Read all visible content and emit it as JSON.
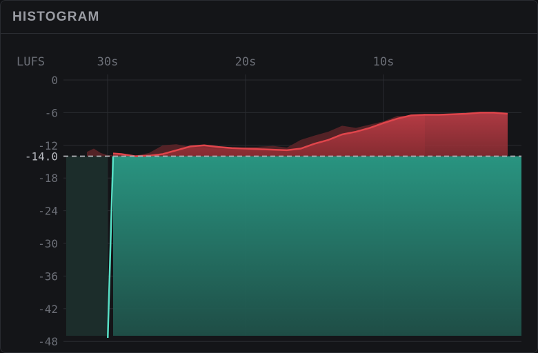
{
  "header": {
    "title": "HISTOGRAM"
  },
  "colors": {
    "background": "#141518",
    "grid": "#2a2c31",
    "text": "#6b6e76",
    "over": "#e0454b",
    "under": "#2a9b86",
    "line": "#57e0c6",
    "target": "#a6a8ad"
  },
  "chart_data": {
    "type": "area",
    "title": "",
    "ylabel": "LUFS",
    "xlabel": "",
    "x_unit": "seconds ago",
    "xlim": [
      33,
      1
    ],
    "ylim": [
      -48,
      0
    ],
    "x_ticks": [
      {
        "value": 30,
        "label": "30s"
      },
      {
        "value": 20,
        "label": "20s"
      },
      {
        "value": 10,
        "label": "10s"
      }
    ],
    "y_ticks": [
      {
        "value": 0,
        "label": "0"
      },
      {
        "value": -6,
        "label": "-6"
      },
      {
        "value": -12,
        "label": "-12"
      },
      {
        "value": -18,
        "label": "-18"
      },
      {
        "value": -24,
        "label": "-24"
      },
      {
        "value": -30,
        "label": "-30"
      },
      {
        "value": -36,
        "label": "-36"
      },
      {
        "value": -42,
        "label": "-42"
      },
      {
        "value": -48,
        "label": "-48"
      }
    ],
    "target": {
      "value": -14.0,
      "label": "-14.0"
    },
    "grid": true,
    "series": [
      {
        "x": [
          33.0,
          32.0,
          31.0,
          30.2,
          30.0,
          29.6,
          29.0,
          28.0,
          27.0,
          26.0,
          25.0,
          24.0,
          23.0,
          22.0,
          21.0,
          20.0,
          19.0,
          18.0,
          17.0,
          16.0,
          15.0,
          14.0,
          13.0,
          12.0,
          11.0,
          10.0,
          9.0,
          8.0,
          7.0,
          6.0,
          5.0,
          4.0,
          3.0,
          2.0,
          1.0
        ],
        "y": [
          -48.4,
          -48.4,
          -48.4,
          -48.4,
          -48.4,
          -13.5,
          -13.6,
          -14.0,
          -13.9,
          -13.6,
          -12.9,
          -12.2,
          -12.0,
          -12.3,
          -12.5,
          -12.6,
          -12.7,
          -12.8,
          -12.9,
          -12.6,
          -11.7,
          -11.0,
          -10.0,
          -9.5,
          -8.8,
          -7.9,
          -7.1,
          -6.5,
          -6.4,
          -6.4,
          -6.3,
          -6.2,
          -6.0,
          -6.0,
          -6.2
        ]
      }
    ],
    "peaks": {
      "x": [
        31.5,
        31.0,
        30.5,
        30.0,
        28.0,
        27.0,
        26.0,
        25.0,
        24.0,
        23.0,
        22.0,
        20.0,
        18.0,
        17.0,
        16.0,
        15.0,
        14.0,
        13.0,
        12.0,
        11.0,
        10.0,
        9.0,
        8.0,
        7.0
      ],
      "y": [
        -13.2,
        -12.6,
        -13.4,
        -13.8,
        -13.9,
        -13.4,
        -12.0,
        -11.8,
        -12.3,
        -12.5,
        -12.7,
        -12.4,
        -12.1,
        -12.4,
        -11.0,
        -10.2,
        -9.5,
        -8.4,
        -8.8,
        -8.2,
        -7.6,
        -6.6,
        -6.6,
        -6.2
      ]
    }
  }
}
